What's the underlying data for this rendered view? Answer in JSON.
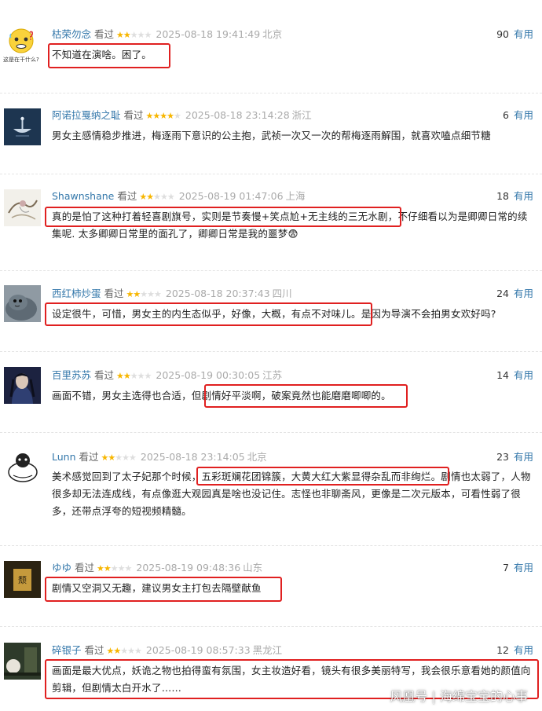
{
  "seen_label": "看过",
  "useful_label": "有用",
  "reviews": [
    {
      "user": "枯荣勿念",
      "rating": 2,
      "time": "2025-08-18 19:41:49",
      "location": "北京",
      "votes": "90",
      "avatar_caption": "这是在干什么?",
      "text": "不知道在演啥。困了。"
    },
    {
      "user": "阿诺拉戛纳之耻",
      "rating": 4,
      "time": "2025-08-18 23:14:28",
      "location": "浙江",
      "votes": "6",
      "text": "男女主感情稳步推进，梅逐雨下意识的公主抱，武祯一次又一次的帮梅逐雨解围，就喜欢嗑点细节糖"
    },
    {
      "user": "Shawnshane",
      "rating": 2,
      "time": "2025-08-19 01:47:06",
      "location": "上海",
      "votes": "18",
      "text": "真的是怕了这种打着轻喜剧旗号，实则是节奏慢+笑点尬+无主线的三无水剧，不仔细看以为是卿卿日常的续集呢. 太多卿卿日常里的面孔了，卿卿日常是我的噩梦😨"
    },
    {
      "user": "西红柿炒蛋",
      "rating": 2,
      "time": "2025-08-18 20:37:43",
      "location": "四川",
      "votes": "24",
      "text": "设定很牛，可惜，男女主的内生态似乎，好像，大概，有点不对味儿。是因为导演不会拍男女欢好吗?"
    },
    {
      "user": "百里苏苏",
      "rating": 2,
      "time": "2025-08-19 00:30:05",
      "location": "江苏",
      "votes": "14",
      "text": "画面不错，男女主选得也合适，但剧情好平淡啊，破案竟然也能磨磨唧唧的。"
    },
    {
      "user": "Lunn",
      "rating": 2,
      "time": "2025-08-18 23:14:05",
      "location": "北京",
      "votes": "23",
      "text": "美术感觉回到了太子妃那个时候，五彩斑斓花团锦簇，大黄大红大紫显得杂乱而非绚烂。剧情也太弱了，人物很多却无法连成线，有点像逛大观园真是啥也没记住。志怪也非聊斋风，更像是二次元版本，可看性弱了很多，还带点浮夸的短视频精髓。"
    },
    {
      "user": "ゆゆ",
      "rating": 2,
      "time": "2025-08-19 09:48:36",
      "location": "山东",
      "votes": "7",
      "avatar_caption": "颓",
      "text": "剧情又空洞又无趣，建议男女主打包去隔壁献鱼"
    },
    {
      "user": "碎银子",
      "rating": 2,
      "time": "2025-08-19 08:57:33",
      "location": "黑龙江",
      "votes": "12",
      "text": "画面是最大优点，妖诡之物也拍得蛮有氛围，女主妆造好看，镜头有很多美丽特写，我会很乐意看她的颜值向剪辑，但剧情太白开水了……"
    }
  ],
  "watermark": "风凰号 | 海绵宝宝的心事"
}
